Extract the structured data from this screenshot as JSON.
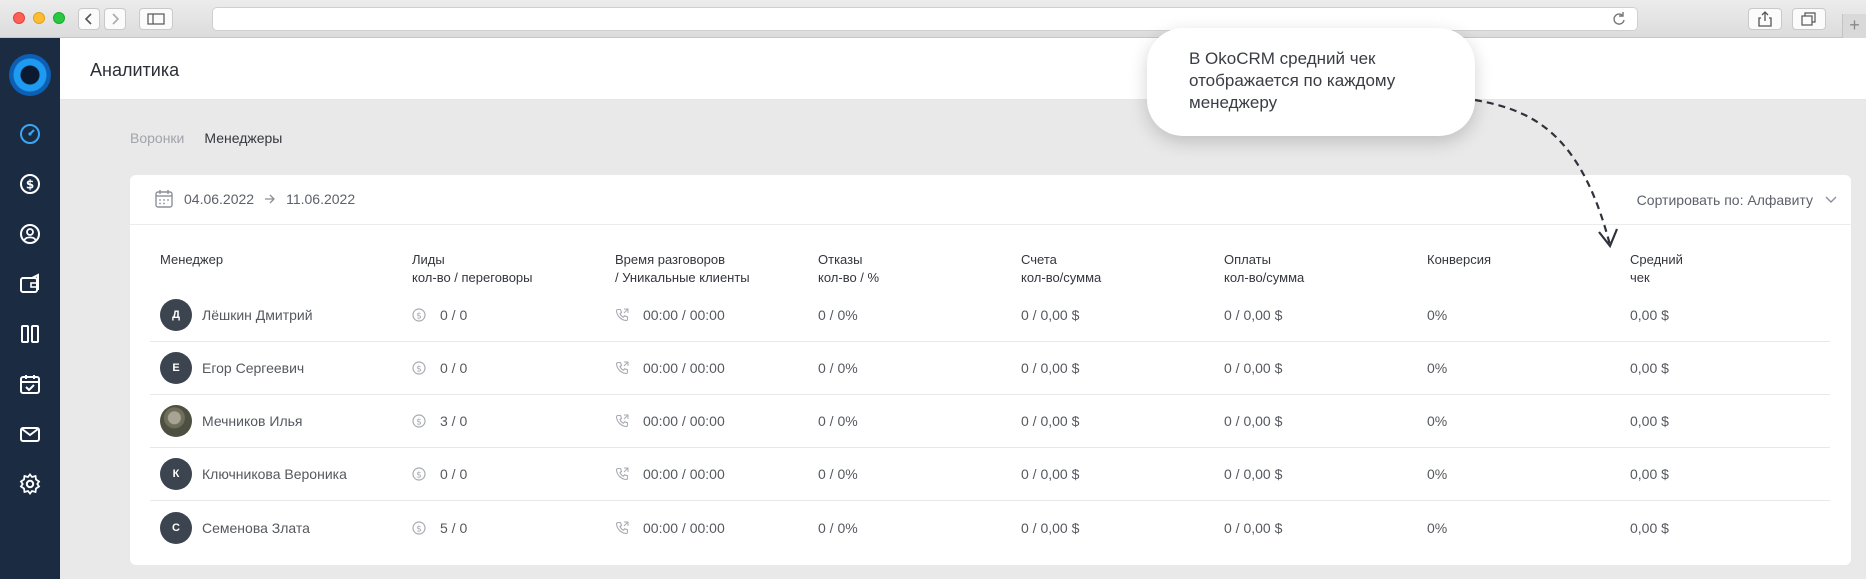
{
  "page": {
    "title": "Аналитика"
  },
  "tabs": [
    {
      "label": "Воронки",
      "active": false
    },
    {
      "label": "Менеджеры",
      "active": true
    }
  ],
  "filter": {
    "date_from": "04.06.2022",
    "date_to": "11.06.2022",
    "sort_label": "Сортировать по: Алфавиту"
  },
  "callout": {
    "text": "В OkoCRM средний чек отображается по каждому менеджеру"
  },
  "columns": [
    "Менеджер",
    "Лиды\nкол-во / переговоры",
    "Время разговоров\n/ Уникальные клиенты",
    "Отказы\nкол-во / %",
    "Счета\nкол-во/сумма",
    "Оплаты\nкол-во/сумма",
    "Конверсия",
    "Средний\nчек"
  ],
  "rows": [
    {
      "initial": "Д",
      "name": "Лёшкин Дмитрий",
      "leads": "0 / 0",
      "calls": "00:00 / 00:00",
      "refusals": "0 / 0%",
      "invoices": "0 / 0,00 $",
      "payments": "0 / 0,00 $",
      "conversion": "0%",
      "avg_check": "0,00 $"
    },
    {
      "initial": "Е",
      "name": "Егор Сергеевич",
      "leads": "0 / 0",
      "calls": "00:00 / 00:00",
      "refusals": "0 / 0%",
      "invoices": "0 / 0,00 $",
      "payments": "0 / 0,00 $",
      "conversion": "0%",
      "avg_check": "0,00 $"
    },
    {
      "initial": "",
      "name": "Мечников Илья",
      "leads": "3 / 0",
      "calls": "00:00 / 00:00",
      "refusals": "0 / 0%",
      "invoices": "0 / 0,00 $",
      "payments": "0 / 0,00 $",
      "conversion": "0%",
      "avg_check": "0,00 $"
    },
    {
      "initial": "К",
      "name": "Ключникова Вероника",
      "leads": "0 / 0",
      "calls": "00:00 / 00:00",
      "refusals": "0 / 0%",
      "invoices": "0 / 0,00 $",
      "payments": "0 / 0,00 $",
      "conversion": "0%",
      "avg_check": "0,00 $"
    },
    {
      "initial": "С",
      "name": "Семенова Злата",
      "leads": "5 / 0",
      "calls": "00:00 / 00:00",
      "refusals": "0 / 0%",
      "invoices": "0 / 0,00 $",
      "payments": "0 / 0,00 $",
      "conversion": "0%",
      "avg_check": "0,00 $"
    }
  ],
  "sidebar": {
    "icons": [
      "dashboard-icon",
      "dollar-icon",
      "user-icon",
      "wallet-icon",
      "kanban-icon",
      "calendar-check-icon",
      "mail-icon",
      "settings-icon"
    ]
  },
  "colors": {
    "sidebar_bg": "#1b2b42",
    "accent": "#1e9bf0"
  }
}
